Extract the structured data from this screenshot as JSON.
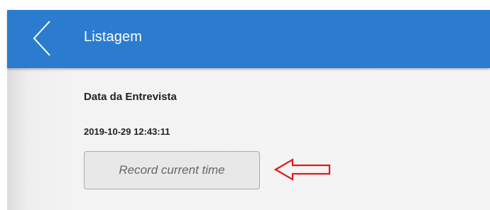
{
  "header": {
    "title": "Listagem",
    "back_icon": "chevron-left-icon",
    "background_color": "#2b7ccf"
  },
  "form": {
    "field_label": "Data da Entrevista",
    "field_value": "2019-10-29 12:43:11",
    "record_button_label": "Record current time"
  },
  "annotation": {
    "icon": "arrow-left-outline-icon",
    "color": "#e01b1b"
  }
}
